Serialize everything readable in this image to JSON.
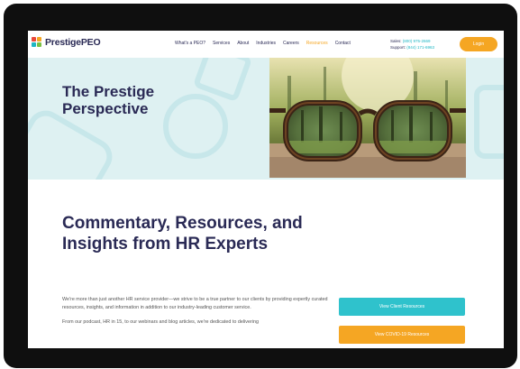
{
  "header": {
    "logo_prestige": "Prestige",
    "logo_peo": "PEO",
    "nav": [
      "What's a PEO?",
      "Services",
      "About",
      "Industries",
      "Careers",
      "Resources",
      "Contact"
    ],
    "active_nav_index": 5,
    "sales_label": "Sales:",
    "sales_number": "(800) 975-2669",
    "support_label": "Support:",
    "support_number": "(844) 171-6963",
    "login_label": "Login"
  },
  "hero": {
    "title": "The Prestige Perspective",
    "image_alt": "eyeglasses on a table focusing a forest"
  },
  "main": {
    "headline": "Commentary, Resources, and Insights from HR Experts",
    "paragraphs": [
      "We're more than just another HR service provider—we strive to be a true partner to our clients by providing expertly curated resources, insights, and information in addition to our industry-leading customer service.",
      "From our podcast, HR in 15, to our webinars and blog articles, we're dedicated to delivering"
    ],
    "cta_primary": "View Client Resources",
    "cta_secondary": "View COVID-19 Resources"
  },
  "colors": {
    "navy": "#2a2a55",
    "accent_orange": "#f5a623",
    "accent_teal": "#2fc2cc",
    "hero_bg": "#def1f2"
  }
}
